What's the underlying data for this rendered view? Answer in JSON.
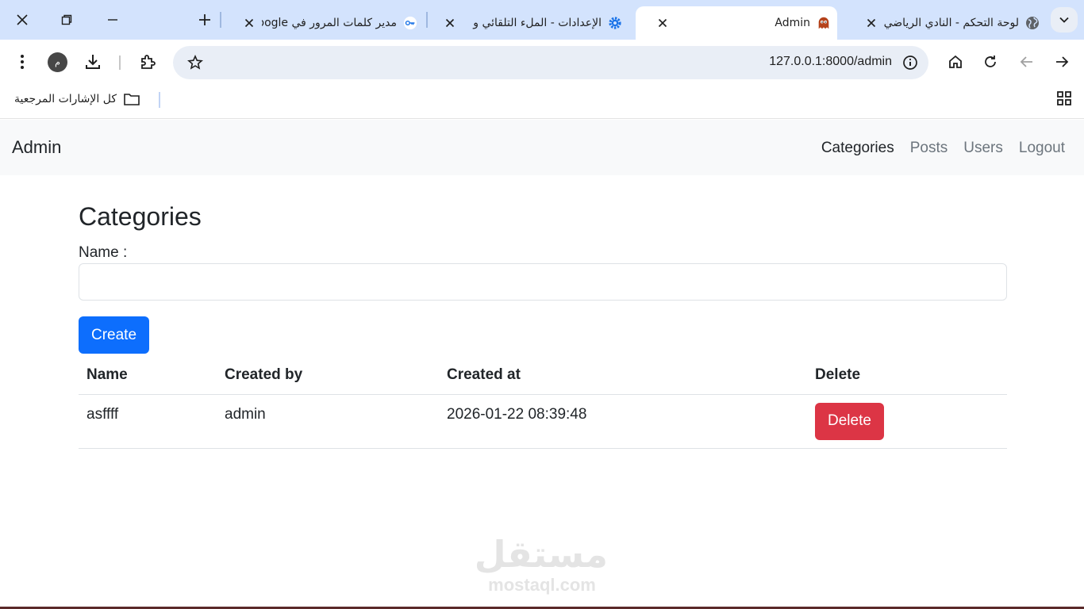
{
  "browser": {
    "tabs": [
      {
        "title": "لوحة التحكم - النادي الرياضي",
        "icon": "globe-icon"
      },
      {
        "title": "Admin",
        "icon": "ghost-icon",
        "active": true
      },
      {
        "title": "الإعدادات - الملء التلقائي و",
        "icon": "gear-icon"
      },
      {
        "title": "مدير كلمات المرور في Google",
        "icon": "key-icon"
      }
    ],
    "url": "127.0.0.1:8000/admin",
    "profile_initial": "م",
    "bookmarks_all_label": "كل الإشارات المرجعية"
  },
  "navbar": {
    "brand": "Admin",
    "links": [
      "Categories",
      "Posts",
      "Users",
      "Logout"
    ],
    "active_link": "Categories"
  },
  "page": {
    "title": "Categories",
    "name_label": "Name :",
    "name_value": "",
    "create_label": "Create"
  },
  "table": {
    "headers": [
      "Name",
      "Created by",
      "Created at",
      "Delete"
    ],
    "rows": [
      {
        "name": "asffff",
        "created_by": "admin",
        "created_at": "2026-01-22 08:39:48",
        "action": "Delete"
      }
    ]
  },
  "watermark": {
    "arabic": "مستقل",
    "latin": "mostaql.com"
  },
  "colors": {
    "primary": "#0d6efd",
    "danger": "#dc3545",
    "tabstrip": "#d3e3fd"
  }
}
